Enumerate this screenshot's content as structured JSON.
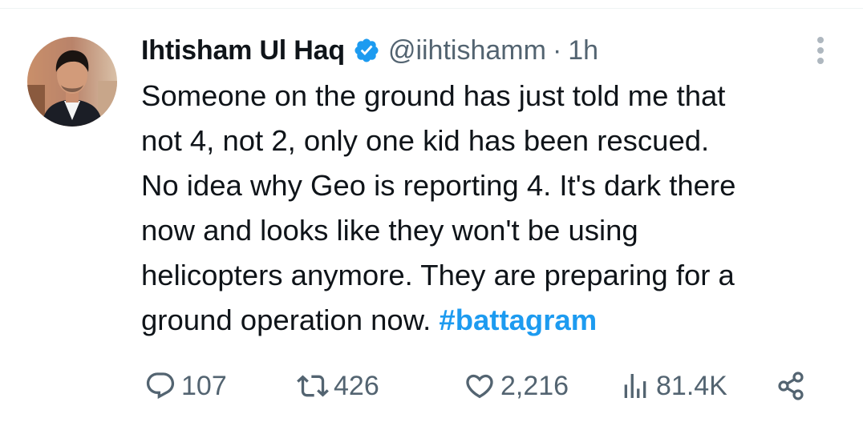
{
  "author": {
    "display_name": "Ihtisham Ul Haq",
    "handle": "@iihtishamm",
    "separator": "·",
    "time": "1h",
    "verified": true
  },
  "tweet": {
    "lines": [
      "Someone on the ground has just told me that",
      "not 4, not 2, only one kid has been rescued.",
      "No idea why Geo is reporting 4. It's dark there",
      "now and looks like they won't be using",
      "helicopters anymore. They are preparing for a",
      "ground operation now."
    ],
    "hashtag": "#battagram"
  },
  "actions": {
    "replies": "107",
    "reposts": "426",
    "likes": "2,216",
    "views": "81.4K"
  },
  "icons": {
    "reply": "reply-icon",
    "repost": "repost-icon",
    "like": "heart-icon",
    "views": "views-icon",
    "share": "share-icon",
    "more": "more-icon",
    "verified": "verified-badge-icon"
  },
  "colors": {
    "link": "#1d9bf0",
    "secondary_text": "#536471",
    "primary_text": "#0f1419",
    "verified": "#1d9bf0"
  }
}
